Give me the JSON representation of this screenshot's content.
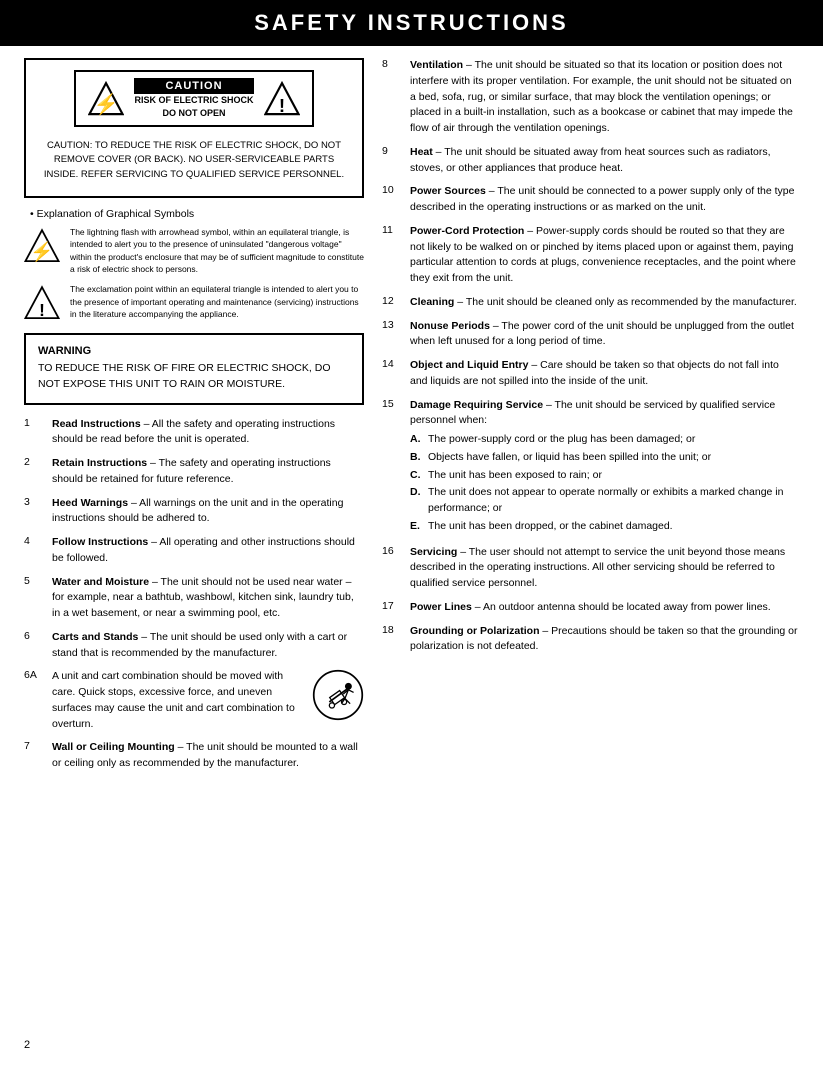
{
  "header": {
    "title": "SAFETY INSTRUCTIONS"
  },
  "caution_box": {
    "label": "CAUTION",
    "sub": "RISK OF ELECTRIC SHOCK\nDO NOT OPEN",
    "body": "CAUTION:  TO REDUCE THE RISK OF ELECTRIC SHOCK, DO NOT REMOVE COVER (OR BACK). NO USER-SERVICEABLE PARTS INSIDE. REFER SERVICING TO QUALIFIED SERVICE PERSONNEL."
  },
  "explanation": {
    "title": "Explanation of Graphical Symbols",
    "symbols": [
      {
        "type": "lightning",
        "text": "The lightning flash with arrowhead symbol, within an equilateral triangle, is intended to alert you to the presence of uninsulated \"dangerous voltage\" within the product's enclosure that may be of sufficient magnitude to constitute a risk of electric shock to persons."
      },
      {
        "type": "exclamation",
        "text": "The exclamation point within an equilateral triangle is intended to alert you to the presence of important operating and maintenance (servicing) instructions in the literature accompanying the appliance."
      }
    ]
  },
  "warning_box": {
    "title": "WARNING",
    "text": "TO REDUCE THE RISK OF FIRE OR ELECTRIC SHOCK, DO NOT EXPOSE THIS UNIT TO RAIN OR MOISTURE."
  },
  "left_instructions": [
    {
      "num": "1",
      "bold": "Read Instructions",
      "text": " – All the safety and operating instructions should be read before the unit is operated."
    },
    {
      "num": "2",
      "bold": "Retain Instructions",
      "text": " – The safety and operating instructions should be retained for future reference."
    },
    {
      "num": "3",
      "bold": "Heed Warnings",
      "text": " – All warnings on the unit and in the operating instructions should be adhered to."
    },
    {
      "num": "4",
      "bold": "Follow Instructions",
      "text": " – All operating and other instructions should be followed."
    },
    {
      "num": "5",
      "bold": "Water and Moisture",
      "text": " – The unit should not be used near water – for example, near a bathtub, washbowl, kitchen sink, laundry tub, in a wet basement, or near a swimming pool, etc."
    },
    {
      "num": "6",
      "bold": "Carts and Stands",
      "text": " – The unit should be used only with a cart or stand that is recommended by the manufacturer."
    },
    {
      "num": "6A",
      "bold": "",
      "text": "A unit and cart combination should be moved with care.  Quick stops, excessive force, and uneven surfaces may cause the unit and cart combination to overturn.",
      "has_cart_icon": true
    },
    {
      "num": "7",
      "bold": "Wall or Ceiling Mounting",
      "text": " – The unit should be mounted to a wall or ceiling only as recommended by the manufacturer."
    }
  ],
  "right_instructions": [
    {
      "num": "8",
      "bold": "Ventilation",
      "text": " – The unit should be situated so that its location or position does not interfere with its proper ventilation.  For example, the unit should not be situated on a bed, sofa, rug, or similar surface, that may block the ventilation openings; or placed in a built-in installation, such as a bookcase or cabinet that may impede the flow of air through the ventilation openings."
    },
    {
      "num": "9",
      "bold": "Heat",
      "text": " – The unit should be situated away from heat sources such as radiators, stoves, or other appliances that produce heat."
    },
    {
      "num": "10",
      "bold": "Power Sources",
      "text": " – The unit should be connected to a power supply only of the type described in the operating instructions or as marked on the unit."
    },
    {
      "num": "11",
      "bold": "Power-Cord Protection",
      "text": " – Power-supply cords should be routed so that they are not likely to be walked on or pinched by items placed upon or against them, paying particular attention to cords at plugs, convenience receptacles, and the point where they exit from the unit."
    },
    {
      "num": "12",
      "bold": "Cleaning",
      "text": " – The unit should be cleaned only as recommended by the manufacturer."
    },
    {
      "num": "13",
      "bold": "Nonuse Periods",
      "text": " – The power cord of the unit should be unplugged from the outlet when left unused for a long period of time."
    },
    {
      "num": "14",
      "bold": "Object and Liquid Entry",
      "text": " – Care should be taken so that objects do not fall into and liquids are not spilled into the inside of the unit."
    },
    {
      "num": "15",
      "bold": "Damage Requiring Service",
      "text": " – The unit should be serviced by qualified service personnel when:",
      "sub_items": [
        {
          "label": "A.",
          "text": "The power-supply cord or the plug has been damaged; or"
        },
        {
          "label": "B.",
          "text": "Objects have fallen, or liquid has been spilled into the unit; or"
        },
        {
          "label": "C.",
          "text": "The unit has been exposed to rain; or"
        },
        {
          "label": "D.",
          "text": "The unit does not appear to operate normally or exhibits a marked change in performance; or"
        },
        {
          "label": "E.",
          "text": "The unit has been dropped, or the cabinet damaged."
        }
      ]
    },
    {
      "num": "16",
      "bold": "Servicing",
      "text": " – The user should not attempt to service the unit beyond those means described in the operating instructions.  All other servicing should be referred to qualified service personnel."
    },
    {
      "num": "17",
      "bold": "Power Lines",
      "text": " – An outdoor antenna should be located away from power lines."
    },
    {
      "num": "18",
      "bold": "Grounding or Polarization",
      "text": " – Precautions should be taken so that the grounding or polarization is not defeated."
    }
  ],
  "page_number": "2"
}
